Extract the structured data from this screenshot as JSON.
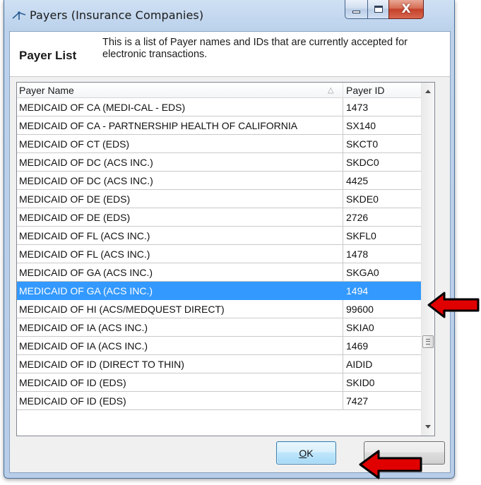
{
  "window": {
    "title": "Payers (Insurance Companies)",
    "icons": {
      "app": "payer-app-icon",
      "minimize": "minimize-icon",
      "maximize": "maximize-icon",
      "close": "close-icon"
    },
    "close_glyph": "X"
  },
  "header": {
    "title": "Payer List",
    "description": "This is a list of Payer names and IDs that are currently accepted for electronic transactions."
  },
  "grid": {
    "columns": {
      "name": "Payer Name",
      "id": "Payer ID"
    },
    "sort_indicator": "△",
    "selected_row_index": 10,
    "rows": [
      {
        "name": "MEDICAID OF CA (MEDI-CAL - EDS)",
        "id": "1473"
      },
      {
        "name": "MEDICAID OF CA - PARTNERSHIP HEALTH OF CALIFORNIA",
        "id": "SX140"
      },
      {
        "name": "MEDICAID OF CT (EDS)",
        "id": "SKCT0"
      },
      {
        "name": "MEDICAID OF DC (ACS INC.)",
        "id": "SKDC0"
      },
      {
        "name": "MEDICAID OF DC (ACS INC.)",
        "id": "4425"
      },
      {
        "name": "MEDICAID OF DE (EDS)",
        "id": "SKDE0"
      },
      {
        "name": "MEDICAID OF DE (EDS)",
        "id": "2726"
      },
      {
        "name": "MEDICAID OF FL (ACS INC.)",
        "id": "SKFL0"
      },
      {
        "name": "MEDICAID OF FL (ACS INC.)",
        "id": "1478"
      },
      {
        "name": "MEDICAID OF GA (ACS INC.)",
        "id": "SKGA0"
      },
      {
        "name": "MEDICAID OF GA (ACS INC.)",
        "id": "1494"
      },
      {
        "name": "MEDICAID OF HI (ACS/MEDQUEST DIRECT)",
        "id": "99600"
      },
      {
        "name": "MEDICAID OF IA (ACS INC.)",
        "id": "SKIA0"
      },
      {
        "name": "MEDICAID OF IA (ACS INC.)",
        "id": "1469"
      },
      {
        "name": "MEDICAID OF ID (DIRECT TO THIN)",
        "id": "AIDID"
      },
      {
        "name": "MEDICAID OF ID (EDS)",
        "id": "SKID0"
      },
      {
        "name": "MEDICAID OF ID (EDS)",
        "id": "7427"
      }
    ],
    "scrollbar": {
      "up_icon": "scroll-up-arrow-icon",
      "down_icon": "scroll-down-arrow-icon",
      "thumb_icon": "scroll-grip-icon"
    }
  },
  "buttons": {
    "ok_mnemonic": "O",
    "ok_rest": "K"
  },
  "annotations": {
    "arrow_icon": "red-arrow-icon",
    "color": "#e00000"
  },
  "colors": {
    "selection": "#3399ff",
    "accent_border": "#3c7fb1"
  }
}
